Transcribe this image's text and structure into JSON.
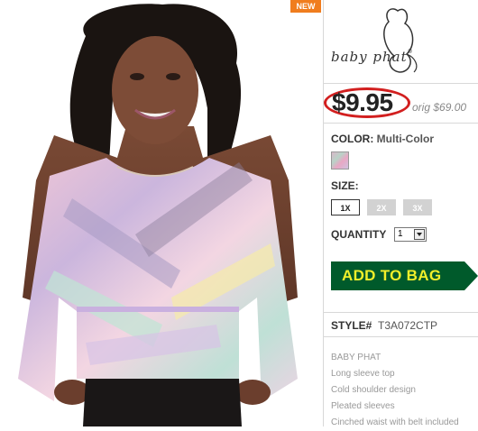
{
  "badge": {
    "new": "NEW"
  },
  "product": {
    "image_alt": "Model wearing multi-color cold shoulder top",
    "brand_logo": {
      "name": "baby phat",
      "icon": "cat-silhouette-icon"
    },
    "price": "$9.95",
    "orig_price": "orig $69.00",
    "color": {
      "label": "COLOR:",
      "value": "Multi-Color"
    },
    "size": {
      "label": "SIZE:",
      "options": [
        "1X",
        "2X",
        "3X"
      ],
      "selected": "1X"
    },
    "quantity": {
      "label": "QUANTITY",
      "value": "1"
    },
    "add_to_bag": "ADD TO BAG",
    "style": {
      "label": "STYLE#",
      "value": "T3A072CTP"
    },
    "details": [
      "BABY PHAT",
      "Long sleeve top",
      "Cold shoulder design",
      "Pleated sleeves",
      "Cinched waist with belt included"
    ]
  },
  "colors": {
    "price_circle": "#d21f1f",
    "add_button_bg": "#005a2b",
    "add_button_text": "#f1ef2a",
    "badge_bg": "#f07d1e"
  }
}
